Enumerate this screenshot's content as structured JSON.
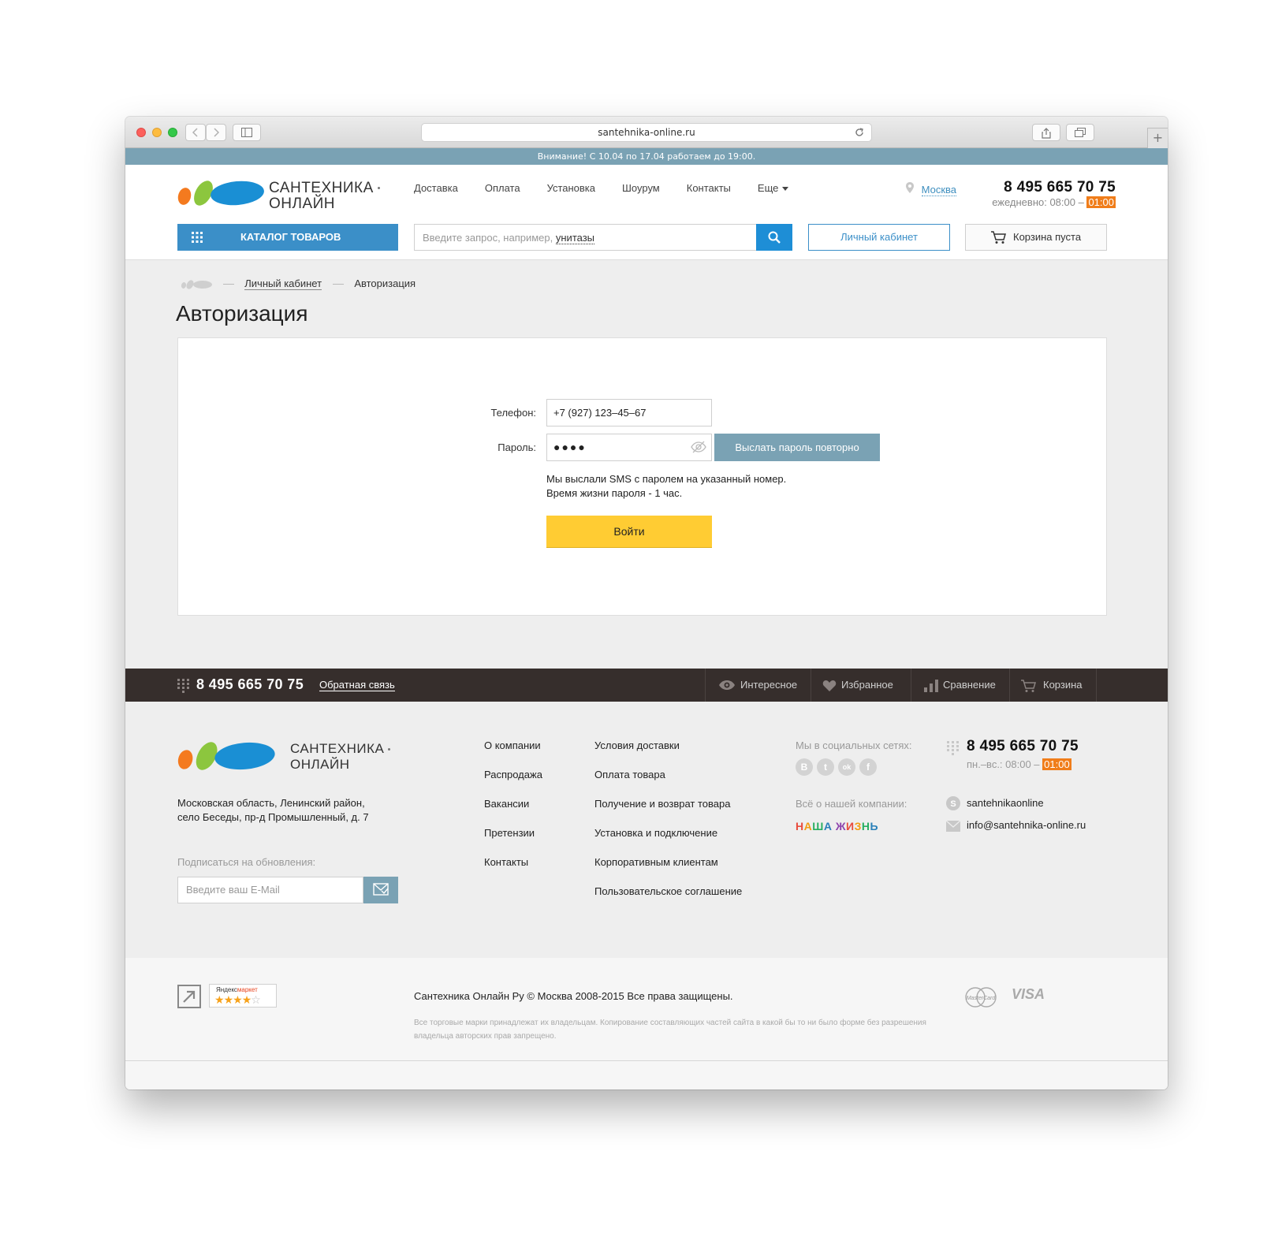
{
  "browser": {
    "url": "santehnika-online.ru",
    "newtab_symbol": "+"
  },
  "notice": "Внимание! С 10.04 по 17.04 работаем до 19:00.",
  "header": {
    "logo_line1": "САНТЕХНИКА",
    "logo_line2": "ОНЛАЙН",
    "nav": [
      "Доставка",
      "Оплата",
      "Установка",
      "Шоурум",
      "Контакты",
      "Еще"
    ],
    "city": "Москва",
    "phone": "8 495 665 70 75",
    "hours_prefix": "ежедневно: 08:00 –",
    "hours_highlight": "01:00",
    "catalog_label": "КАТАЛОГ ТОВАРОВ",
    "search_placeholder": "Введите запрос, например,",
    "search_example": "унитазы",
    "cabinet_label": "Личный кабинет",
    "cart_label": "Корзина пуста"
  },
  "breadcrumb": {
    "items": [
      "Личный кабинет",
      "Авторизация"
    ]
  },
  "page_title": "Авторизация",
  "auth": {
    "phone_label": "Телефон:",
    "phone_value": "+7 (927) 123–45–67",
    "password_label": "Пароль:",
    "password_value": "●●●●",
    "resend_label": "Выслать пароль повторно",
    "sms_line1": "Мы выслали SMS с паролем на указанный номер.",
    "sms_line2": "Время жизни пароля - 1 час.",
    "login_label": "Войти"
  },
  "darkbar": {
    "phone": "8 495 665 70 75",
    "feedback": "Обратная связь",
    "tabs": [
      "Интересное",
      "Избранное",
      "Сравнение",
      "Корзина"
    ]
  },
  "footer": {
    "logo_line1": "САНТЕХНИКА",
    "logo_line2": "ОНЛАЙН",
    "address_line1": "Московская область, Ленинский район,",
    "address_line2": "село Беседы, пр-д Промышленный, д. 7",
    "subscribe_label": "Подписаться на обновления:",
    "subscribe_placeholder": "Введите ваш E-Mail",
    "col1": [
      "О компании",
      "Распродажа",
      "Вакансии",
      "Претензии",
      "Контакты"
    ],
    "col2": [
      "Условия доставки",
      "Оплата товара",
      "Получение и возврат товара",
      "Установка и подключение",
      "Корпоративным клиентам",
      "Пользовательское соглашение"
    ],
    "social_label": "Мы в социальных сетях:",
    "social": [
      "B",
      "t",
      "ok",
      "f"
    ],
    "about_label": "Всё о нашей компании:",
    "nasha_letters": [
      "Н",
      "А",
      "Ш",
      "А",
      " ",
      "Ж",
      "И",
      "З",
      "Н",
      "Ь"
    ],
    "nasha_colors": [
      "#e84c3d",
      "#f39c12",
      "#27ae60",
      "#2980b9",
      "#ffffff",
      "#8e44ad",
      "#e84c3d",
      "#f39c12",
      "#27ae60",
      "#2980b9"
    ],
    "phone": "8 495 665 70 75",
    "hours_prefix": "пн.–вс.: 08:00 –",
    "hours_highlight": "01:00",
    "skype": "santehnikaonline",
    "email": "info@santehnika-online.ru"
  },
  "bottom": {
    "ymarket_label_black": "Яндекс",
    "ymarket_label_red": "маркет",
    "ymarket_rating": 4,
    "copyright": "Сантехника Онлайн Ру © Москва 2008-2015 Все права защищены.",
    "legal": "Все торговые марки принадлежат их владельцам. Копирование составляющих частей сайта в какой бы то ни было форме без разрешения владельца авторских прав запрещено.",
    "mastercard": "MasterCard",
    "visa": "VISA"
  },
  "colors": {
    "accent_blue": "#3b8fc8",
    "notice_bar": "#7aa2b4",
    "login_yellow": "#ffcc33",
    "dark_bar": "#362e2c",
    "hours_orange": "#f07d1a"
  }
}
